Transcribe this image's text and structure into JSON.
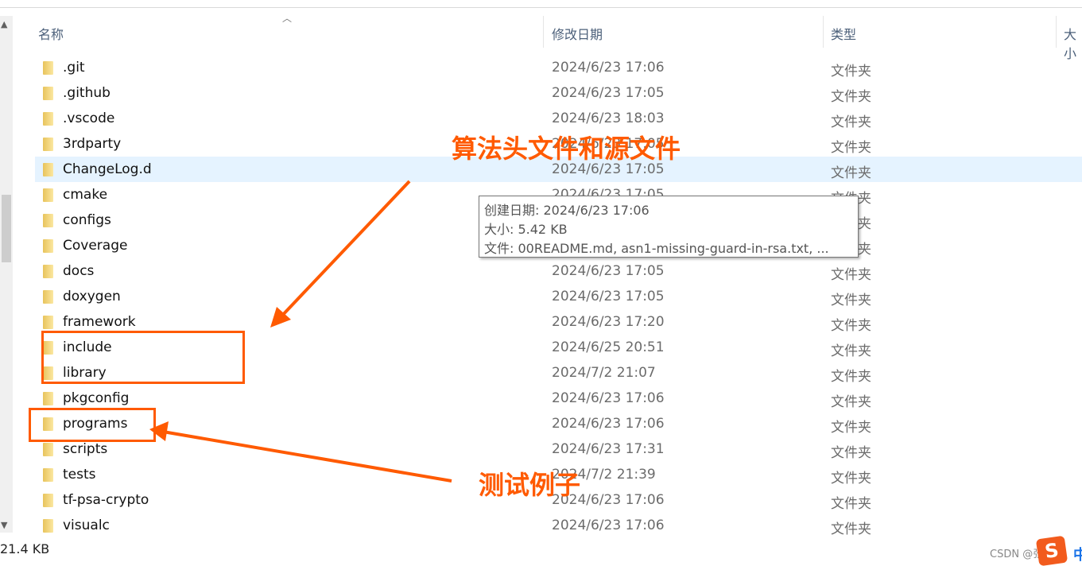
{
  "header": {
    "name": "名称",
    "date": "修改日期",
    "type": "类型",
    "size": "大小"
  },
  "rows": [
    {
      "name": ".git",
      "date": "2024/6/23 17:06",
      "type": "文件夹"
    },
    {
      "name": ".github",
      "date": "2024/6/23 17:05",
      "type": "文件夹"
    },
    {
      "name": ".vscode",
      "date": "2024/6/23 18:03",
      "type": "文件夹"
    },
    {
      "name": "3rdparty",
      "date": "2024/6/23 17:05",
      "type": "文件夹"
    },
    {
      "name": "ChangeLog.d",
      "date": "2024/6/23 17:05",
      "type": "文件夹"
    },
    {
      "name": "cmake",
      "date": "2024/6/23 17:05",
      "type": "文件夹"
    },
    {
      "name": "configs",
      "date": "",
      "type": "文件夹"
    },
    {
      "name": "Coverage",
      "date": "",
      "type": "文件夹"
    },
    {
      "name": "docs",
      "date": "2024/6/23 17:05",
      "type": "文件夹"
    },
    {
      "name": "doxygen",
      "date": "2024/6/23 17:05",
      "type": "文件夹"
    },
    {
      "name": "framework",
      "date": "2024/6/23 17:20",
      "type": "文件夹"
    },
    {
      "name": "include",
      "date": "2024/6/25 20:51",
      "type": "文件夹"
    },
    {
      "name": "library",
      "date": "2024/7/2 21:07",
      "type": "文件夹"
    },
    {
      "name": "pkgconfig",
      "date": "2024/6/23 17:06",
      "type": "文件夹"
    },
    {
      "name": "programs",
      "date": "2024/6/23 17:06",
      "type": "文件夹"
    },
    {
      "name": "scripts",
      "date": "2024/6/23 17:31",
      "type": "文件夹"
    },
    {
      "name": "tests",
      "date": "2024/7/2 21:39",
      "type": "文件夹"
    },
    {
      "name": "tf-psa-crypto",
      "date": "2024/6/23 17:06",
      "type": "文件夹"
    },
    {
      "name": "visualc",
      "date": "2024/6/23 17:06",
      "type": "文件夹"
    }
  ],
  "tooltip": {
    "created": "创建日期: 2024/6/23 17:06",
    "size": "大小: 5.42 KB",
    "files": "文件: 00README.md, asn1-missing-guard-in-rsa.txt, ..."
  },
  "status": "21.4 KB",
  "annotations": {
    "top": "算法头文件和源文件",
    "bottom": "测试例子",
    "color": "#ff5a00"
  },
  "watermark": "CSDN @张三西",
  "ime": "中"
}
